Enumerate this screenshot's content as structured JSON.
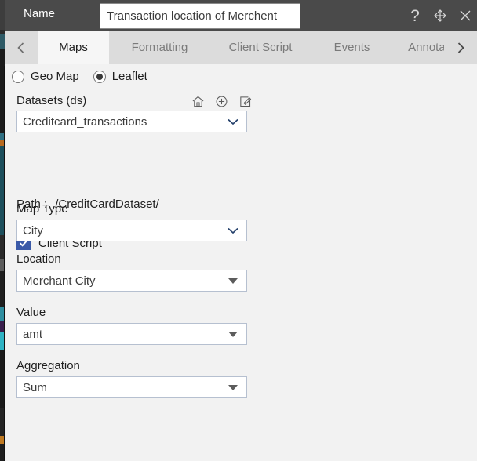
{
  "titlebar": {
    "name_label": "Name",
    "name_value": "Transaction location of Merchent",
    "name_placeholder": "Name",
    "help_icon": "question-mark-help-icon",
    "move_icon": "move-four-arrows-icon",
    "close_icon": "close-x-icon"
  },
  "tabbar": {
    "prev_icon": "chevron-left-icon",
    "next_icon": "chevron-right-icon",
    "tabs": [
      {
        "label": "Maps",
        "active": true
      },
      {
        "label": "Formatting",
        "active": false
      },
      {
        "label": "Client Script",
        "active": false
      },
      {
        "label": "Events",
        "active": false
      },
      {
        "label": "Annotation",
        "active": false
      }
    ]
  },
  "form": {
    "map_engine": {
      "options": [
        {
          "label": "Geo Map",
          "selected": false
        },
        {
          "label": "Leaflet",
          "selected": true
        }
      ]
    },
    "datasets": {
      "label": "Datasets (ds)",
      "value": "Creditcard_transactions",
      "icons": [
        "home-icon",
        "add-circle-icon",
        "edit-pencil-icon"
      ]
    },
    "path": {
      "label": "Path :",
      "value": "/CreditCardDataset/"
    },
    "client_script": {
      "label": "Client Script",
      "checked": true
    },
    "map_type": {
      "label": "Map Type",
      "value": "City"
    },
    "location": {
      "label": "Location",
      "value": "Merchant City"
    },
    "value_field": {
      "label": "Value",
      "value": "amt"
    },
    "aggregation": {
      "label": "Aggregation",
      "value": "Sum"
    }
  },
  "colors": {
    "titlebar_bg": "#4a4a4a",
    "tabbar_bg": "#dcdcdc",
    "active_tab_bg": "#f6f6f6",
    "panel_bg": "#f2f2f2",
    "checkbox_blue": "#3b5aa8",
    "field_border": "#b6c0d0"
  }
}
